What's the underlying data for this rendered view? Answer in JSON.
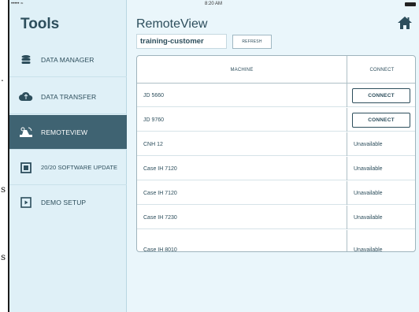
{
  "status": {
    "signal": "••••• ⁠≈",
    "time": "8:20 AM"
  },
  "margin_marks": [
    ".",
    "s",
    "s"
  ],
  "sidebar": {
    "title": "Tools",
    "items": [
      {
        "label": "DATA MANAGER",
        "icon": "database-icon",
        "active": false
      },
      {
        "label": "DATA TRANSFER",
        "icon": "cloud-transfer-icon",
        "active": false
      },
      {
        "label": "REMOTEVIEW",
        "icon": "remoteview-icon",
        "active": true
      },
      {
        "label": "20/20 SOFTWARE UPDATE",
        "icon": "monitor-update-icon",
        "active": false
      },
      {
        "label": "DEMO SETUP",
        "icon": "demo-play-icon",
        "active": false
      }
    ]
  },
  "main": {
    "title": "RemoteView",
    "customer_value": "training-customer",
    "refresh_label": "REFRESH",
    "table": {
      "headers": {
        "machine": "MACHINE",
        "connect": "CONNECT"
      },
      "rows": [
        {
          "machine": "JD 5660",
          "action": "CONNECT",
          "available": true
        },
        {
          "machine": "JD 9760",
          "action": "CONNECT",
          "available": true
        },
        {
          "machine": "CNH 12",
          "action": "Unavailable",
          "available": false
        },
        {
          "machine": "Case IH 7120",
          "action": "Unavailable",
          "available": false
        },
        {
          "machine": "Case IH 7120",
          "action": "Unavailable",
          "available": false
        },
        {
          "machine": "Case IH 7230",
          "action": "Unavailable",
          "available": false
        },
        {
          "machine": "Case IH 8010",
          "action": "Unavailable",
          "available": false
        }
      ]
    }
  },
  "colors": {
    "sidebar_bg": "#dff0f7",
    "active_bg": "#3f6372",
    "text": "#2d4e5c",
    "main_bg": "#eaf6fb"
  }
}
